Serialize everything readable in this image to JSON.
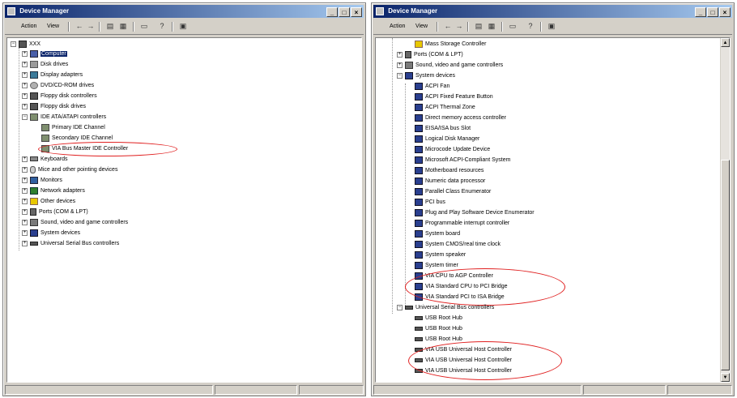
{
  "left": {
    "title": "Device Manager",
    "menu": [
      "Action",
      "View"
    ],
    "root": "XXX",
    "items": [
      "Computer",
      "Disk drives",
      "Display adapters",
      "DVD/CD-ROM drives",
      "Floppy disk controllers",
      "Floppy disk drives",
      "IDE ATA/ATAPI controllers",
      "Primary IDE Channel",
      "Secondary IDE Channel",
      "VIA Bus Master IDE Controller",
      "Keyboards",
      "Mice and other pointing devices",
      "Monitors",
      "Network adapters",
      "Other devices",
      "Ports (COM & LPT)",
      "Sound, video and game controllers",
      "System devices",
      "Universal Serial Bus controllers"
    ]
  },
  "right": {
    "title": "Device Manager",
    "menu": [
      "Action",
      "View"
    ],
    "items": [
      "Mass Storage Controller",
      "Ports (COM & LPT)",
      "Sound, video and game controllers",
      "System devices",
      "ACPI Fan",
      "ACPI Fixed Feature Button",
      "ACPI Thermal Zone",
      "Direct memory access controller",
      "EISA/ISA bus Slot",
      "Logical Disk Manager",
      "Microcode Update Device",
      "Microsoft ACPI-Compliant System",
      "Motherboard resources",
      "Numeric data processor",
      "Parallel Class Enumerator",
      "PCI bus",
      "Plug and Play Software Device Enumerator",
      "Programmable interrupt controller",
      "System board",
      "System CMOS/real time clock",
      "System speaker",
      "System timer",
      "VIA CPU to AGP Controller",
      "VIA Standard CPU to PCI Bridge",
      "VIA Standard PCI to ISA Bridge",
      "Universal Serial Bus controllers",
      "USB Root Hub",
      "USB Root Hub",
      "USB Root Hub",
      "VIA USB Universal Host Controller",
      "VIA USB Universal Host Controller",
      "VIA USB Universal Host Controller"
    ]
  },
  "colors": {
    "titlebar": "#0a246a",
    "highlight": "#e02020",
    "chrome": "#d4d0c8"
  }
}
